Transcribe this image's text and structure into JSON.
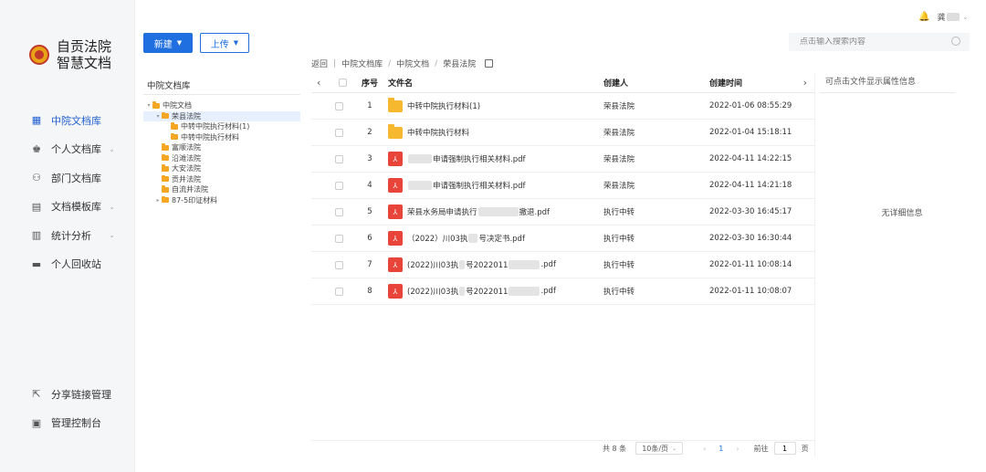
{
  "brand": {
    "line1": "自贡法院",
    "line2": "智慧文档"
  },
  "nav": [
    {
      "label": "中院文档库",
      "icon": "library-icon",
      "active": true,
      "chevron": false
    },
    {
      "label": "个人文档库",
      "icon": "star-icon",
      "active": false,
      "chevron": true
    },
    {
      "label": "部门文档库",
      "icon": "users-icon",
      "active": false,
      "chevron": false
    },
    {
      "label": "文档模板库",
      "icon": "template-icon",
      "active": false,
      "chevron": true
    },
    {
      "label": "统计分析",
      "icon": "chart-icon",
      "active": false,
      "chevron": true
    },
    {
      "label": "个人回收站",
      "icon": "trash-icon",
      "active": false,
      "chevron": false
    }
  ],
  "nav_bottom": [
    {
      "label": "分享链接管理",
      "icon": "share-icon"
    },
    {
      "label": "管理控制台",
      "icon": "console-icon"
    }
  ],
  "toolbar": {
    "new_label": "新建",
    "upload_label": "上传"
  },
  "user": {
    "name": "龚"
  },
  "search": {
    "placeholder": "点击输入搜索内容"
  },
  "breadcrumb": {
    "back": "返回",
    "items": [
      "中院文档库",
      "中院文档",
      "荣县法院"
    ]
  },
  "tree": {
    "title": "中院文档库",
    "nodes": [
      {
        "label": "中院文档",
        "level": 0,
        "arrow": "down",
        "selected": false
      },
      {
        "label": "荣县法院",
        "level": 1,
        "arrow": "down",
        "selected": true
      },
      {
        "label": "中转中院执行材料(1)",
        "level": 2,
        "arrow": "",
        "selected": false
      },
      {
        "label": "中转中院执行材料",
        "level": 2,
        "arrow": "",
        "selected": false
      },
      {
        "label": "富顺法院",
        "level": 1,
        "arrow": "",
        "selected": false
      },
      {
        "label": "沿滩法院",
        "level": 1,
        "arrow": "",
        "selected": false
      },
      {
        "label": "大安法院",
        "level": 1,
        "arrow": "",
        "selected": false
      },
      {
        "label": "贡井法院",
        "level": 1,
        "arrow": "",
        "selected": false
      },
      {
        "label": "自流井法院",
        "level": 1,
        "arrow": "",
        "selected": false
      },
      {
        "label": "87-5印证材料",
        "level": 1,
        "arrow": "right",
        "selected": false
      }
    ]
  },
  "table": {
    "headers": {
      "seq": "序号",
      "name": "文件名",
      "creator": "创建人",
      "time": "创建时间"
    },
    "rows": [
      {
        "seq": "1",
        "type": "folder",
        "name_a": "中转中院执行材料(1)",
        "mask": 0,
        "name_b": "",
        "creator": "荣县法院",
        "time": "2022-01-06 08:55:29"
      },
      {
        "seq": "2",
        "type": "folder",
        "name_a": "中转中院执行材料",
        "mask": 0,
        "name_b": "",
        "creator": "荣县法院",
        "time": "2022-01-04 15:18:11"
      },
      {
        "seq": "3",
        "type": "pdf",
        "name_a": "",
        "mask": 26,
        "name_b": "申请强制执行相关材料.pdf",
        "creator": "荣县法院",
        "time": "2022-04-11 14:22:15"
      },
      {
        "seq": "4",
        "type": "pdf",
        "name_a": "",
        "mask": 26,
        "name_b": "申请强制执行相关材料.pdf",
        "creator": "荣县法院",
        "time": "2022-04-11 14:21:18"
      },
      {
        "seq": "5",
        "type": "pdf",
        "name_a": "荣县水务局申请执行",
        "mask": 44,
        "name_b": "撤退.pdf",
        "creator": "执行中转",
        "time": "2022-03-30 16:45:17"
      },
      {
        "seq": "6",
        "type": "pdf",
        "name_a": "（2022）川03执",
        "mask": 10,
        "name_b": "号决定书.pdf",
        "creator": "执行中转",
        "time": "2022-03-30 16:30:44"
      },
      {
        "seq": "7",
        "type": "pdf",
        "name_a": "(2022)川03执",
        "mask": 6,
        "name_b": "号2022011",
        "mask2": 34,
        "name_c": ".pdf",
        "creator": "执行中转",
        "time": "2022-01-11 10:08:14"
      },
      {
        "seq": "8",
        "type": "pdf",
        "name_a": "(2022)川03执",
        "mask": 6,
        "name_b": "号2022011",
        "mask2": 34,
        "name_c": ".pdf",
        "creator": "执行中转",
        "time": "2022-01-11 10:08:07"
      }
    ]
  },
  "details": {
    "title": "可点击文件显示属性信息",
    "empty": "无详细信息"
  },
  "pager": {
    "total": "共 8 条",
    "page_size": "10条/页",
    "current": "1",
    "goto_label": "前往",
    "goto_value": "1",
    "page_unit": "页"
  }
}
